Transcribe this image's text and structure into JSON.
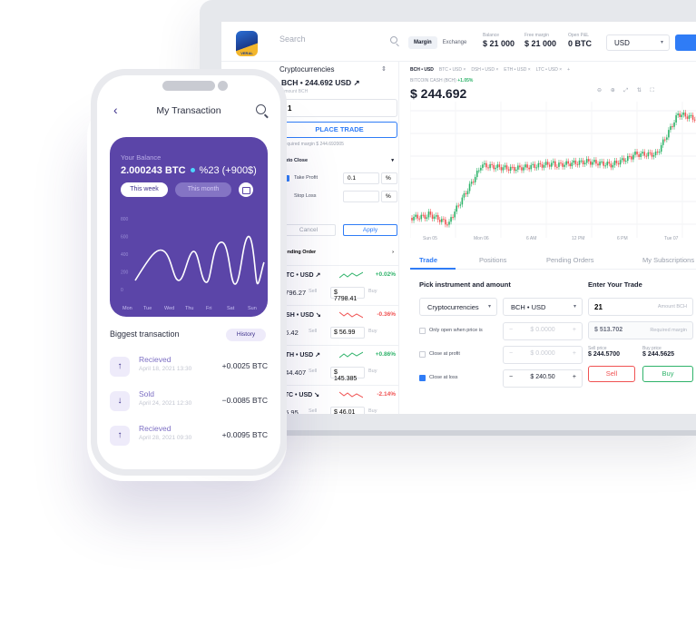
{
  "desktop": {
    "search_placeholder": "Search",
    "mode_tabs": [
      "Margin",
      "Exchange"
    ],
    "stats": [
      {
        "label": "Balance",
        "value": "$ 21 000"
      },
      {
        "label": "Free margin",
        "value": "$ 21 000"
      },
      {
        "label": "Open P&L",
        "value": "0 BTC"
      }
    ],
    "currency": "USD",
    "market_header": "Cryptocurrencies",
    "selected_pair": "BCH • 244.692 USD ↗",
    "amount_label": "Amount BCH",
    "amount_value": "1",
    "place_trade": "PLACE TRADE",
    "required_margin": "Required margin $ 244.692005",
    "auto_close": "Auto Close",
    "take_profit_label": "Take Profit",
    "take_profit_value": "0.1",
    "take_profit_unit": "%",
    "stop_loss_label": "Stop Loss",
    "stop_loss_unit": "%",
    "cancel": "Cancel",
    "apply": "Apply",
    "pending_order": "Pending Order",
    "markets": [
      {
        "name": "BTC • USD ↗",
        "change": "+0.02%",
        "sell": "7796.27",
        "buy": "$ 7798.41",
        "up": true
      },
      {
        "name": "DSH • USD ↘",
        "change": "-0.36%",
        "sell": "56.42",
        "buy": "$ 56.99",
        "up": false
      },
      {
        "name": "ETH • USD ↗",
        "change": "+0.86%",
        "sell": "144.407",
        "buy": "$ 145.385",
        "up": true
      },
      {
        "name": "LTC • USD ↘",
        "change": "-2.14%",
        "sell": "45.95",
        "buy": "$ 46.01",
        "up": false
      },
      {
        "name": "XMR • USD ↘",
        "change": "-1.06%",
        "sell": "59.2738",
        "buy": "$ 59.3602",
        "up": false
      }
    ],
    "sell_label": "Sell",
    "buy_label": "Buy",
    "chart_tabs": [
      "BCH • USD",
      "BTC • USD",
      "DSH • USD",
      "ETH • USD",
      "LTC • USD",
      "+"
    ],
    "chart_name": "BITCOIN CASH (BCH)",
    "chart_change": "+1.05%",
    "chart_price": "$ 244.692",
    "chart_tools": "⊖ ⊕ ⤢ ⇅ ⛶",
    "x_ticks": [
      "Sun 05",
      "Mon 06",
      "6 AM",
      "12 PM",
      "6 PM",
      "Tue 07"
    ],
    "bottom_tabs": [
      "Trade",
      "Positions",
      "Pending Orders",
      "My Subscriptions"
    ],
    "pick_title": "Pick instrument and amount",
    "instrument_type": "Cryptocurrencies",
    "instrument": "BCH • USD",
    "only_open": "Only open when price is",
    "close_profit": "Close at profit",
    "close_loss": "Close at loss",
    "stepper_placeholder": "$ 0.0000",
    "close_loss_value": "$ 240.50",
    "enter_title": "Enter Your Trade",
    "trade_amount": "21",
    "trade_amount_label": "Amount BCH",
    "margin_value": "$ 513.702",
    "margin_label": "Required margin",
    "sell_price_label": "Sell price",
    "sell_price": "$ 244.5700",
    "buy_price_label": "Buy price",
    "buy_price": "$ 244.5625",
    "sell_btn": "Sell",
    "buy_btn": "Buy"
  },
  "phone": {
    "title": "My Transaction",
    "balance_label": "Your Balance",
    "balance": "2.000243 BTC",
    "balance_change": "%23 (+900$)",
    "this_week": "This week",
    "this_month": "This month",
    "y_ticks": [
      "800",
      "600",
      "400",
      "200",
      "0"
    ],
    "days": [
      "Mon",
      "Tue",
      "Wed",
      "Thu",
      "Fri",
      "Sat",
      "Sun"
    ],
    "section_title": "Biggest transaction",
    "history_btn": "History",
    "transactions": [
      {
        "title": "Recieved",
        "date": "April 18, 2021 13:30",
        "amount": "+0.0025 BTC",
        "icon": "↑"
      },
      {
        "title": "Sold",
        "date": "April 24, 2021 12:30",
        "amount": "−0.0085 BTC",
        "icon": "↓"
      },
      {
        "title": "Recieved",
        "date": "April 28, 2021 09:30",
        "amount": "+0.0095 BTC",
        "icon": "↑"
      }
    ]
  },
  "colors": {
    "accent": "#2f7cf6",
    "up": "#2fb36a",
    "down": "#f05252",
    "purple": "#5b45a8"
  }
}
